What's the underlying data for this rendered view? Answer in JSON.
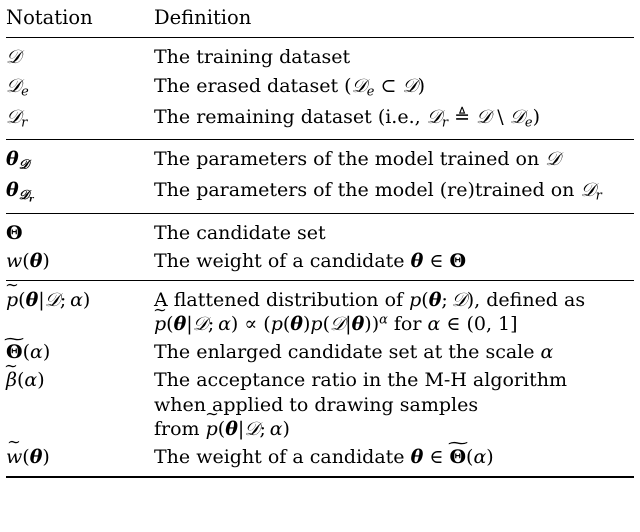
{
  "table": {
    "headers": {
      "notation": "Notation",
      "definition": "Definition"
    },
    "groups": [
      {
        "rows": [
          {
            "notation_html": "D",
            "definition_html": "The training dataset"
          },
          {
            "notation_html": "D_e",
            "definition_html": "The erased dataset (D_e ⊂ D)"
          },
          {
            "notation_html": "D_r",
            "definition_html": "The remaining dataset (i.e., D_r ≜ D \\ D_e)"
          }
        ]
      },
      {
        "rows": [
          {
            "notation_html": "θ_D",
            "definition_html": "The parameters of the model trained on D"
          },
          {
            "notation_html": "θ_{D_r}",
            "definition_html": "The parameters of the model (re)trained on D_r"
          }
        ]
      },
      {
        "rows": [
          {
            "notation_html": "Θ",
            "definition_html": "The candidate set"
          },
          {
            "notation_html": "w(θ)",
            "definition_html": "The weight of a candidate θ ∈ Θ"
          }
        ]
      },
      {
        "rows": [
          {
            "notation_html": "p̃(θ|D;α)",
            "definition_html": "A flattened distribution of p(θ; D), defined as p̃(θ|D;α) ∝ (p(θ)p(D|θ))^α for α ∈ (0, 1]"
          },
          {
            "notation_html": "Θ̃(α)",
            "definition_html": "The enlarged candidate set at the scale α"
          },
          {
            "notation_html": "β̃(α)",
            "definition_html": "The acceptance ratio in the M-H algorithm when applied to drawing samples from p̃(θ|D;α)"
          },
          {
            "notation_html": "w̃(θ)",
            "definition_html": "The weight of a candidate θ ∈ Θ̃(α)"
          }
        ]
      }
    ],
    "definition_lines": {
      "r1": "The training dataset",
      "r2_a": "The erased dataset (",
      "r2_b": "⊂",
      "r2_c": ")",
      "r3_a": "The remaining dataset (i.e., ",
      "r3_b": "≜",
      "r3_c": "\\",
      "r3_d": ")",
      "r4": "The parameters of the model trained on ",
      "r5": "The parameters of the model (re)trained on ",
      "r6": "The candidate set",
      "r7_a": "The weight of a candidate ",
      "r7_b": "∈",
      "r8_l1_a": "A flattened distribution of ",
      "r8_l1_b": ", defined as",
      "r8_l2_a": "∝",
      "r8_l2_b": "for",
      "r8_l2_c": "∈ (0, 1]",
      "r9": "The enlarged candidate set at the scale ",
      "r10_l1": "The acceptance ratio in the M-H algorithm",
      "r10_l2": "when applied to drawing samples",
      "r10_l3": "from ",
      "r11_a": "The weight of a candidate ",
      "r11_b": "∈"
    },
    "symbols": {
      "D": "𝒟",
      "theta": "θ",
      "Theta": "Θ",
      "alpha": "α",
      "beta": "β",
      "p": "p",
      "w": "w",
      "e": "e",
      "r": "r",
      "tilde": "∼",
      "lparen": "(",
      "rparen": ")",
      "bar": "|",
      "semi": ";"
    }
  }
}
